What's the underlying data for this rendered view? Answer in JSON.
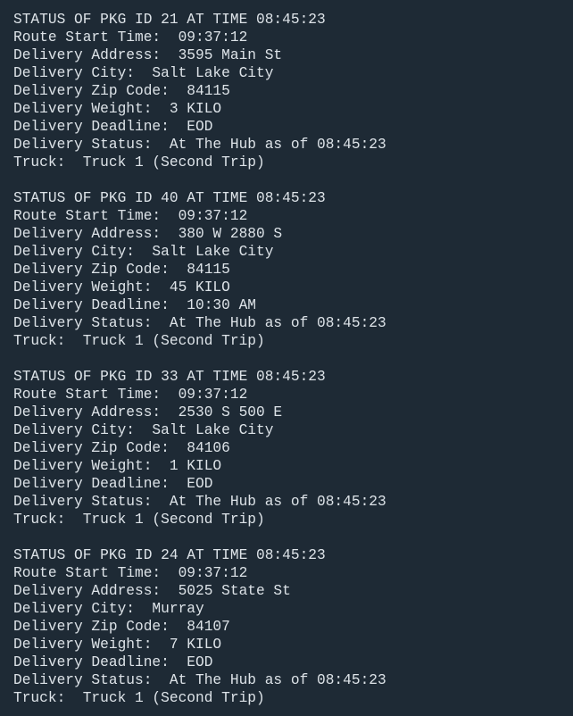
{
  "console": {
    "blocks": [
      {
        "lines": [
          "STATUS OF PKG ID 21 AT TIME 08:45:23",
          "Route Start Time:  09:37:12",
          "Delivery Address:  3595 Main St",
          "Delivery City:  Salt Lake City",
          "Delivery Zip Code:  84115",
          "Delivery Weight:  3 KILO",
          "Delivery Deadline:  EOD",
          "Delivery Status:  At The Hub as of 08:45:23",
          "Truck:  Truck 1 (Second Trip)"
        ]
      },
      {
        "lines": [
          "STATUS OF PKG ID 40 AT TIME 08:45:23",
          "Route Start Time:  09:37:12",
          "Delivery Address:  380 W 2880 S",
          "Delivery City:  Salt Lake City",
          "Delivery Zip Code:  84115",
          "Delivery Weight:  45 KILO",
          "Delivery Deadline:  10:30 AM",
          "Delivery Status:  At The Hub as of 08:45:23",
          "Truck:  Truck 1 (Second Trip)"
        ]
      },
      {
        "lines": [
          "STATUS OF PKG ID 33 AT TIME 08:45:23",
          "Route Start Time:  09:37:12",
          "Delivery Address:  2530 S 500 E",
          "Delivery City:  Salt Lake City",
          "Delivery Zip Code:  84106",
          "Delivery Weight:  1 KILO",
          "Delivery Deadline:  EOD",
          "Delivery Status:  At The Hub as of 08:45:23",
          "Truck:  Truck 1 (Second Trip)"
        ]
      },
      {
        "lines": [
          "STATUS OF PKG ID 24 AT TIME 08:45:23",
          "Route Start Time:  09:37:12",
          "Delivery Address:  5025 State St",
          "Delivery City:  Murray",
          "Delivery Zip Code:  84107",
          "Delivery Weight:  7 KILO",
          "Delivery Deadline:  EOD",
          "Delivery Status:  At The Hub as of 08:45:23",
          "Truck:  Truck 1 (Second Trip)"
        ]
      }
    ]
  },
  "colors": {
    "background": "#1e2a35",
    "text": "#dde3e8"
  }
}
